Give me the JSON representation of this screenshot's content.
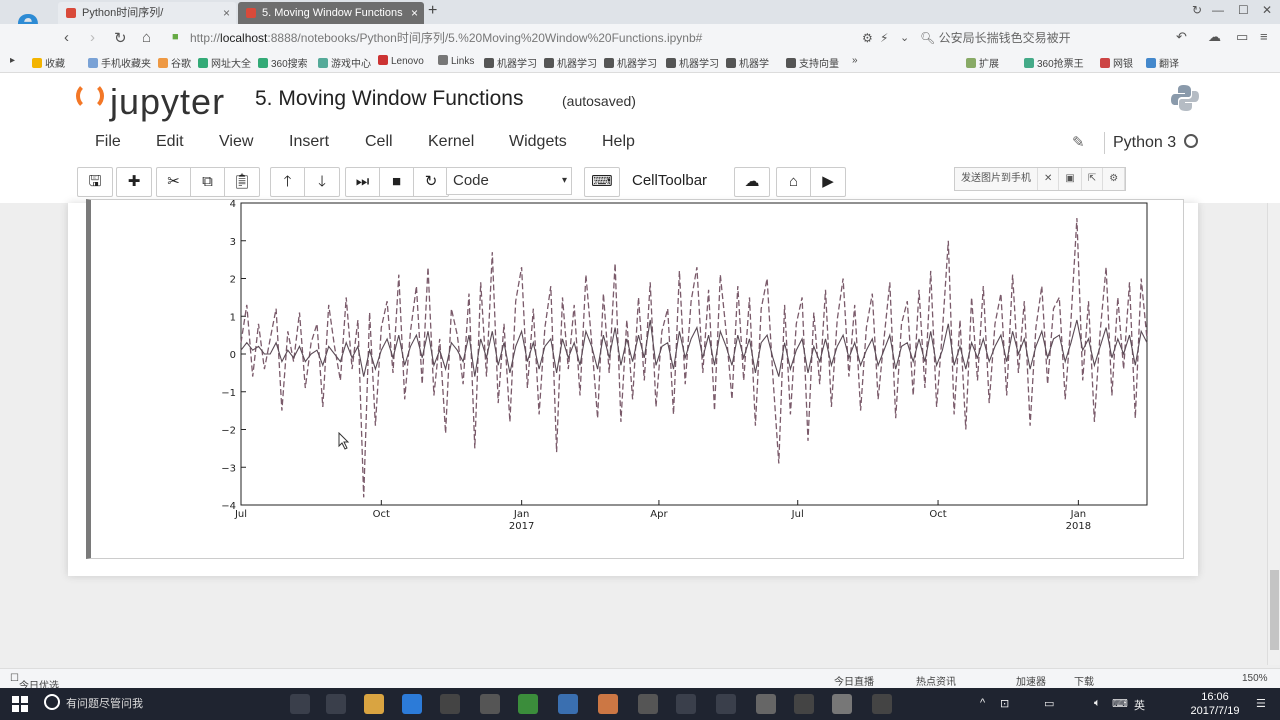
{
  "browser": {
    "tabs": [
      {
        "label": "Python时间序列/"
      },
      {
        "label": "5. Moving Window Functions"
      }
    ],
    "url_prefix": "http://",
    "url_host": "localhost",
    "url_rest": ":8888/notebooks/Python时间序列/5.%20Moving%20Window%20Functions.ipynb#",
    "search_text": "公安局长揣钱色交易被开",
    "bookmarks": [
      "收藏",
      "手机收藏夹",
      "谷歌",
      "网址大全",
      "360搜索",
      "游戏中心",
      "Lenovo",
      "Links",
      "机器学习",
      "机器学习",
      "机器学习",
      "机器学习",
      "机器学",
      "支持向量",
      "扩展",
      "360抢票王",
      "网银",
      "翻译"
    ]
  },
  "jupyter": {
    "logo_text": "jupyter",
    "notebook_title": "5. Moving Window Functions",
    "save_status": "(autosaved)",
    "menu": [
      "File",
      "Edit",
      "View",
      "Insert",
      "Cell",
      "Kernel",
      "Widgets",
      "Help"
    ],
    "kernel_name": "Python 3",
    "cell_type": "Code",
    "celltoolbar_label": "CellToolbar",
    "ext_label": "发送图片到手机"
  },
  "chart_data": {
    "type": "line",
    "title": "",
    "xlabel": "",
    "ylabel": "",
    "ylim": [
      -4,
      4
    ],
    "yticks": [
      "4",
      "3",
      "2",
      "1",
      "0",
      "−1",
      "−2",
      "−3",
      "−4"
    ],
    "xticks": [
      {
        "label": "Jul",
        "year": ""
      },
      {
        "label": "Oct",
        "year": ""
      },
      {
        "label": "Jan",
        "year": "2017"
      },
      {
        "label": "Apr",
        "year": ""
      },
      {
        "label": "Jul",
        "year": ""
      },
      {
        "label": "Oct",
        "year": ""
      },
      {
        "label": "Jan",
        "year": "2018"
      }
    ],
    "x_start": "2016-07-01",
    "x_end": "2018-02-15",
    "series": [
      {
        "style": "dashed",
        "color": "#7a5a6a",
        "values": [
          0.3,
          1.3,
          -0.6,
          0.8,
          -0.4,
          0.4,
          1.2,
          -1.5,
          0.6,
          -0.2,
          1.1,
          -0.9,
          0.3,
          0.8,
          -1.4,
          1.3,
          0.2,
          -0.7,
          1.5,
          -0.4,
          0.9,
          -3.8,
          1.1,
          -1.9,
          0.7,
          1.4,
          -0.5,
          2.1,
          -1.2,
          0.6,
          1.8,
          -0.8,
          2.3,
          -1.1,
          0.4,
          -2.1,
          1.2,
          0.5,
          -0.8,
          1.6,
          -2.5,
          1.9,
          -0.6,
          2.7,
          -1.3,
          0.8,
          -1.8,
          1.4,
          2.3,
          -0.9,
          1.2,
          -1.6,
          0.7,
          1.8,
          -2.6,
          1.5,
          -0.4,
          1.3,
          -1.1,
          2.1,
          0.3,
          -1.7,
          1.6,
          -0.5,
          2.4,
          -1.8,
          0.9,
          -1.2,
          1.5,
          -0.7,
          1.9,
          -1.4,
          0.6,
          1.2,
          -1.6,
          2.2,
          -0.8,
          1.4,
          2.3,
          -0.5,
          1.7,
          -1.5,
          2.1,
          0.6,
          -1.2,
          1.8,
          -0.7,
          1.5,
          -1.9,
          1.2,
          2.0,
          -0.6,
          -2.9,
          1.3,
          -1.6,
          0.8,
          1.5,
          -2.3,
          1.1,
          -0.8,
          1.7,
          -1.4,
          0.9,
          2.0,
          -0.6,
          1.3,
          -1.5,
          0.7,
          1.6,
          -1.2,
          0.4,
          1.9,
          -1.7,
          0.8,
          1.4,
          -1.1,
          1.7,
          -0.9,
          2.2,
          -1.4,
          0.6,
          3.0,
          -1.6,
          0.9,
          -2.0,
          1.5,
          -0.7,
          1.8,
          -1.3,
          0.8,
          1.6,
          -1.1,
          2.1,
          -0.5,
          1.4,
          -1.9,
          0.7,
          1.8,
          -0.8,
          1.2,
          1.5,
          -1.2,
          0.9,
          3.6,
          -0.7,
          1.4,
          -1.8,
          0.6,
          2.3,
          -1.1,
          1.5,
          -0.4,
          1.9,
          -1.7,
          2.0,
          0.4
        ]
      },
      {
        "style": "solid",
        "color": "#5a4a55",
        "values": [
          0.1,
          0.3,
          0.1,
          0.2,
          0.0,
          0.0,
          0.3,
          -0.2,
          0.1,
          -0.1,
          0.2,
          -0.2,
          0.0,
          0.1,
          -0.3,
          0.2,
          0.0,
          -0.2,
          0.3,
          -0.1,
          0.2,
          -0.6,
          0.1,
          -0.4,
          0.1,
          0.4,
          -0.1,
          0.5,
          -0.3,
          0.2,
          0.5,
          -0.1,
          0.6,
          -0.3,
          0.1,
          -0.4,
          0.3,
          0.1,
          -0.2,
          0.5,
          -0.6,
          0.4,
          -0.1,
          0.6,
          -0.3,
          0.3,
          -0.5,
          0.2,
          0.6,
          -0.2,
          0.3,
          -0.4,
          0.2,
          0.4,
          -0.5,
          0.4,
          -0.1,
          0.3,
          -0.3,
          0.6,
          0.2,
          -0.4,
          0.5,
          -0.1,
          0.7,
          -0.3,
          0.4,
          -0.2,
          0.5,
          -0.1,
          0.9,
          -0.3,
          0.2,
          0.3,
          -0.4,
          0.6,
          -0.1,
          0.4,
          0.7,
          -0.1,
          0.5,
          -0.3,
          0.6,
          0.2,
          -0.3,
          0.5,
          -0.1,
          0.4,
          -0.5,
          0.3,
          0.5,
          -0.1,
          -0.6,
          0.3,
          -0.4,
          0.1,
          0.4,
          -0.5,
          0.2,
          -0.2,
          0.4,
          -0.3,
          0.2,
          0.5,
          -0.1,
          0.3,
          -0.3,
          0.1,
          0.4,
          -0.3,
          0.1,
          0.5,
          -0.4,
          0.2,
          0.3,
          -0.2,
          0.4,
          -0.2,
          0.6,
          -0.3,
          0.1,
          0.8,
          -0.3,
          0.2,
          -0.4,
          0.3,
          -0.1,
          0.4,
          -0.2,
          0.2,
          0.5,
          -0.2,
          0.6,
          0.0,
          0.4,
          -0.4,
          0.2,
          0.6,
          -0.1,
          0.4,
          0.5,
          -0.2,
          0.3,
          0.9,
          0.1,
          0.4,
          -0.3,
          0.2,
          0.7,
          -0.1,
          0.4,
          0.0,
          0.5,
          -0.3,
          0.6,
          0.3
        ]
      }
    ]
  },
  "statusbar": {
    "left": "今日优选",
    "items": [
      "今日直播",
      "热点资讯",
      "加速器",
      "下载",
      "150%"
    ]
  },
  "taskbar": {
    "search_text": "有问题尽管问我",
    "lang": "英",
    "time": "16:06",
    "date": "2017/7/19"
  }
}
